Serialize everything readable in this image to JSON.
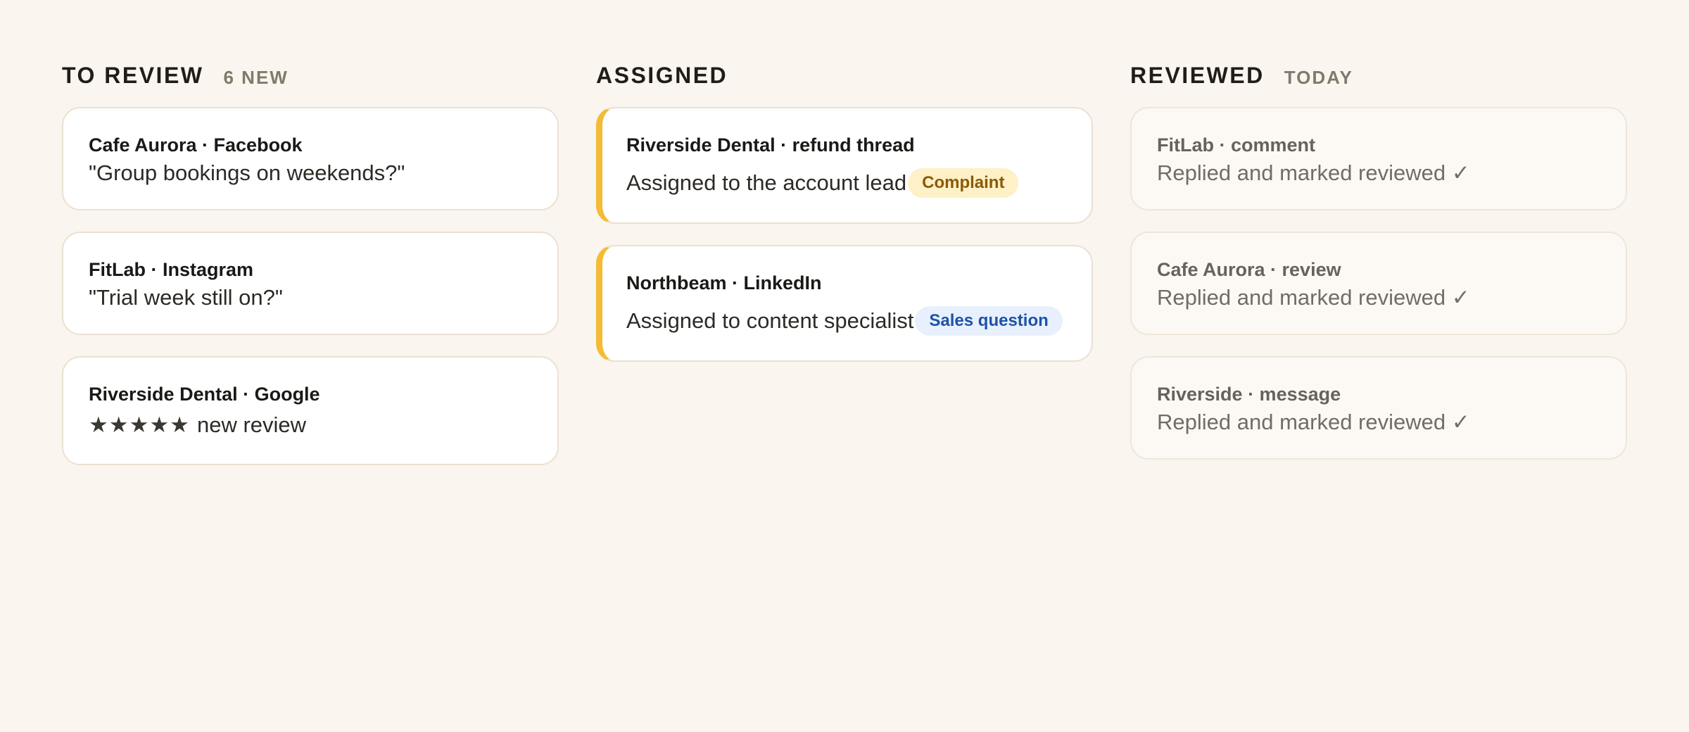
{
  "columns": {
    "to_review": {
      "title": "TO REVIEW",
      "meta": "6 NEW",
      "cards": [
        {
          "title": "Cafe Aurora · Facebook",
          "body": "\"Group bookings on weekends?\""
        },
        {
          "title": "FitLab · Instagram",
          "body": "\"Trial week still on?\""
        },
        {
          "title": "Riverside Dental · Google",
          "stars": "★★★★★",
          "body": "new review"
        }
      ]
    },
    "assigned": {
      "title": "ASSIGNED",
      "cards": [
        {
          "title": "Riverside Dental · refund thread",
          "body": "Assigned to the account lead",
          "tag": "Complaint"
        },
        {
          "title": "Northbeam · LinkedIn",
          "body": "Assigned to content specialist",
          "tag": "Sales question"
        }
      ]
    },
    "reviewed": {
      "title": "REVIEWED",
      "meta": "TODAY",
      "cards": [
        {
          "title": "FitLab · comment",
          "body": "Replied and marked reviewed ✓"
        },
        {
          "title": "Cafe Aurora · review",
          "body": "Replied and marked reviewed ✓"
        },
        {
          "title": "Riverside · message",
          "body": "Replied and marked reviewed ✓"
        }
      ]
    }
  },
  "colors": {
    "background": "#faf5ee",
    "assigned_accent": "#f3bb36",
    "complaint_tag_bg": "#fef0c7",
    "complaint_tag_text": "#8a5a06",
    "sales_tag_bg": "#e8f0fd",
    "sales_tag_text": "#1d52a8"
  }
}
